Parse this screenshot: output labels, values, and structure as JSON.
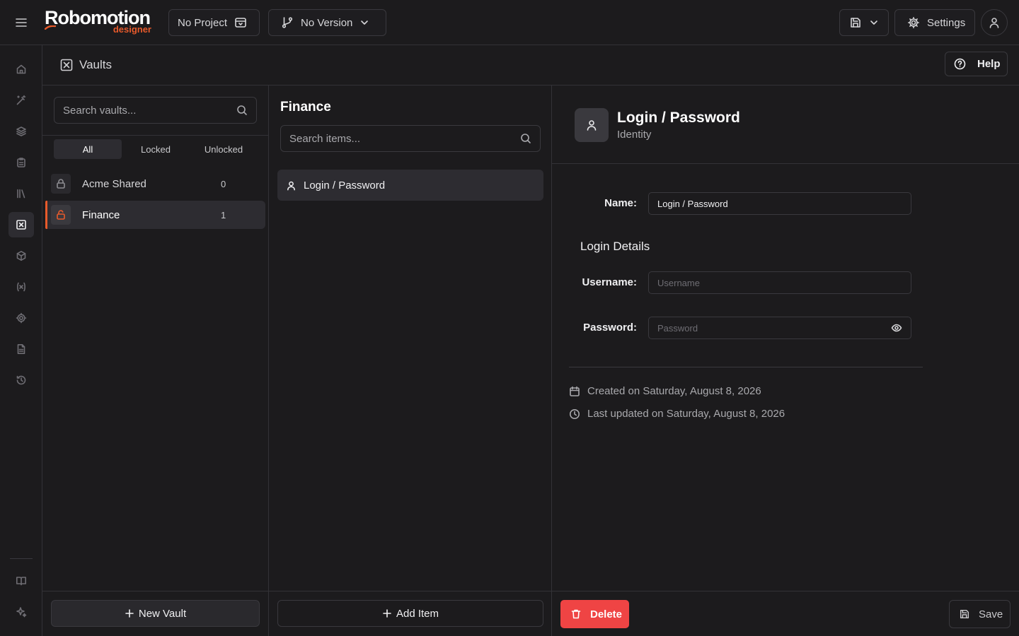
{
  "app": {
    "logo_main": "Robomotion",
    "logo_sub": "designer",
    "brand_color": "#e85a2b",
    "danger_color": "#ef4444"
  },
  "topbar": {
    "project_label": "No Project",
    "version_label": "No Version",
    "settings_label": "Settings"
  },
  "rail": {
    "items": [
      "home-icon",
      "wand-icon",
      "layers-icon",
      "clipboard-icon",
      "library-icon",
      "vault-icon",
      "package-icon",
      "variable-icon",
      "gear-icon",
      "file-icon",
      "history-icon"
    ],
    "bottom": [
      "book-icon",
      "sparkle-icon"
    ],
    "active": "vault-icon"
  },
  "header": {
    "title": "Vaults",
    "help_label": "Help"
  },
  "vaults": {
    "search_placeholder": "Search vaults...",
    "filters": [
      {
        "label": "All",
        "active": true
      },
      {
        "label": "Locked",
        "active": false
      },
      {
        "label": "Unlocked",
        "active": false
      }
    ],
    "items": [
      {
        "name": "Acme Shared",
        "count": "0",
        "locked": true,
        "active": false
      },
      {
        "name": "Finance",
        "count": "1",
        "locked": false,
        "active": true
      }
    ],
    "new_vault_label": "New Vault"
  },
  "items_panel": {
    "title": "Finance",
    "search_placeholder": "Search items...",
    "items": [
      {
        "label": "Login / Password",
        "active": true
      }
    ],
    "add_item_label": "Add Item"
  },
  "detail": {
    "title": "Login / Password",
    "type": "Identity",
    "name_label": "Name:",
    "name_value": "Login / Password",
    "section_title": "Login Details",
    "username_label": "Username:",
    "username_placeholder": "Username",
    "password_label": "Password:",
    "password_placeholder": "Password",
    "created": "Created on Saturday, August 8, 2026",
    "updated": "Last updated on Saturday, August 8, 2026",
    "delete_label": "Delete",
    "save_label": "Save"
  }
}
